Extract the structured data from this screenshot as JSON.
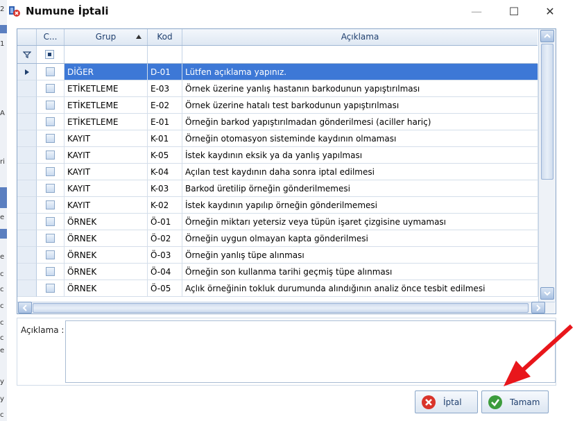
{
  "window": {
    "title": "Numune İptali",
    "minimize_glyph": "—",
    "maximize_glyph": "☐",
    "close_glyph": "✕"
  },
  "background_fragments": [
    "2",
    "1",
    "A",
    "ri",
    "e",
    "e",
    "c",
    "c",
    "c",
    "c",
    "c",
    "e",
    "y",
    "y",
    "c"
  ],
  "grid": {
    "columns": {
      "check": "C...",
      "group": "Grup",
      "code": "Kod",
      "desc": "Açıklama"
    },
    "sort_column": "Grup",
    "selected_row": 0,
    "rows": [
      {
        "group": "DİĞER",
        "code": "D-01",
        "desc": "Lütfen açıklama yapınız."
      },
      {
        "group": "ETİKETLEME",
        "code": "E-03",
        "desc": "Örnek üzerine yanlış hastanın barkodunun yapıştırılması"
      },
      {
        "group": "ETİKETLEME",
        "code": "E-02",
        "desc": "Örnek üzerine hatalı test barkodunun yapıştırılması"
      },
      {
        "group": "ETİKETLEME",
        "code": "E-01",
        "desc": "Örneğin barkod yapıştırılmadan gönderilmesi (aciller hariç)"
      },
      {
        "group": "KAYIT",
        "code": "K-01",
        "desc": "Örneğin otomasyon sisteminde kaydının olmaması"
      },
      {
        "group": "KAYIT",
        "code": "K-05",
        "desc": "İstek kaydının eksik ya da yanlış yapılması"
      },
      {
        "group": "KAYIT",
        "code": "K-04",
        "desc": "Açılan test kaydının daha sonra iptal edilmesi"
      },
      {
        "group": "KAYIT",
        "code": "K-03",
        "desc": "Barkod üretilip örneğin gönderilmemesi"
      },
      {
        "group": "KAYIT",
        "code": "K-02",
        "desc": "İstek kaydının yapılıp örneğin gönderilmemesi"
      },
      {
        "group": "ÖRNEK",
        "code": "Ö-01",
        "desc": "Örneğin miktarı yetersiz veya tüpün işaret çizgisine uymaması"
      },
      {
        "group": "ÖRNEK",
        "code": "Ö-02",
        "desc": "Örneğin uygun olmayan kapta gönderilmesi"
      },
      {
        "group": "ÖRNEK",
        "code": "Ö-03",
        "desc": "Örneğin yanlış tüpe alınması"
      },
      {
        "group": "ÖRNEK",
        "code": "Ö-04",
        "desc": "Örneğin son kullanma tarihi geçmiş tüpe alınması"
      },
      {
        "group": "ÖRNEK",
        "code": "Ö-05",
        "desc": "Açlık örneğinin tokluk durumunda alındığının analiz önce tesbit edilmesi"
      }
    ]
  },
  "description": {
    "label": "Açıklama :",
    "value": ""
  },
  "buttons": {
    "cancel": "İptal",
    "ok": "Tamam"
  },
  "colors": {
    "selection": "#3d78d6",
    "annotation_arrow": "#e8161b",
    "cancel_icon": "#d9342b",
    "ok_icon": "#3c9c3c"
  }
}
